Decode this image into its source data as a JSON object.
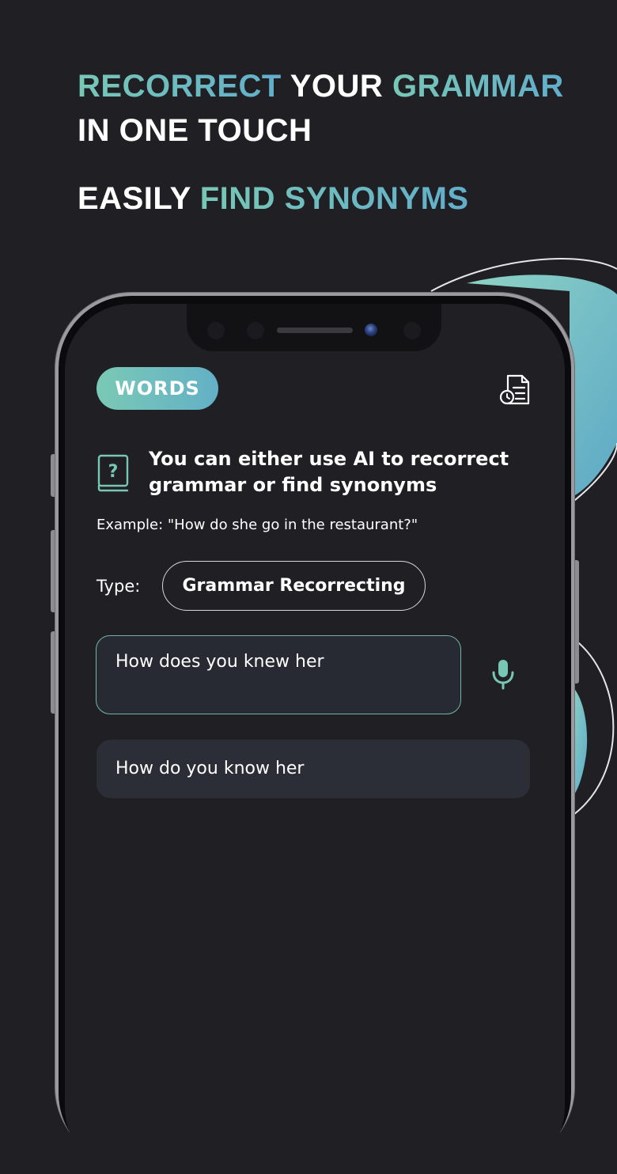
{
  "headline": {
    "line1": {
      "accent1": "RECORRECT",
      "plain": "YOUR",
      "accent2": "GRAMMAR"
    },
    "line2": "IN ONE TOUCH",
    "line3": {
      "plain": "EASILY",
      "accent": "FIND SYNONYMS"
    }
  },
  "app": {
    "mode_button": "WORDS",
    "history_icon": "document-history-icon",
    "info_icon": "book-question-icon",
    "intro_text": "You can either use AI to recorrect grammar or find synonyms",
    "example_text": "Example: \"How do she go in the restaurant?\"",
    "type_label": "Type:",
    "type_value": "Grammar Recorrecting",
    "input_value": "How does you knew her",
    "mic_icon": "microphone-icon",
    "result_text": "How do you know her"
  },
  "colors": {
    "background": "#202024",
    "accent_teal": "#78c7b6",
    "accent_blue": "#62aecb",
    "input_border": "#6fb5a8",
    "result_bg": "#2b2e37",
    "text": "#ffffff"
  }
}
